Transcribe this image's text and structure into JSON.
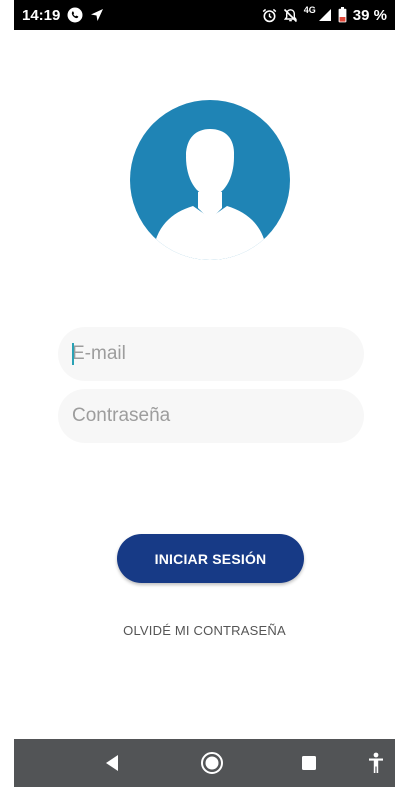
{
  "status_bar": {
    "time": "14:19",
    "network": "4G",
    "battery": "39 %",
    "icons": [
      "whatsapp-icon",
      "location-arrow-icon",
      "alarm-icon",
      "notifications-off-icon",
      "signal-icon",
      "battery-icon"
    ]
  },
  "avatar": {
    "icon": "user-silhouette-icon",
    "color": "#1f84b5"
  },
  "form": {
    "email_placeholder": "E-mail",
    "password_placeholder": "Contraseña",
    "login_label": "INICIAR SESIÓN",
    "forgot_label": "OLVIDÉ MI CONTRASEÑA"
  },
  "colors": {
    "primary_button": "#173a86",
    "input_bg": "#f7f7f7",
    "nav_bar": "#525456",
    "cursor": "#2aa2b5"
  },
  "nav_bar": {
    "icons": [
      "back-icon",
      "home-icon",
      "recents-icon",
      "accessibility-icon"
    ]
  }
}
